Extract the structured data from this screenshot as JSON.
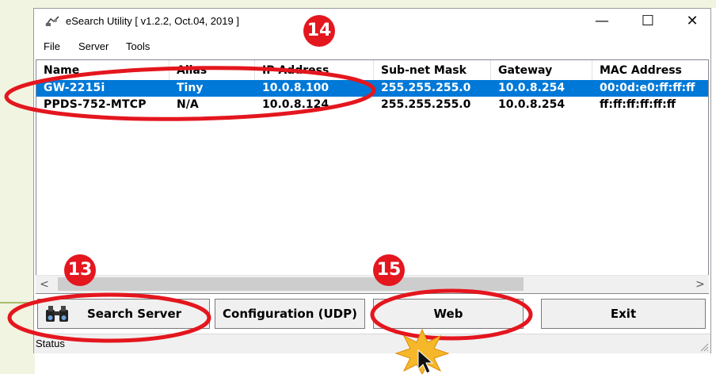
{
  "window": {
    "title": "eSearch Utility [ v1.2.2, Oct.04, 2019 ]",
    "controls": {
      "minimize": "—",
      "maximize": "☐",
      "close": "✕"
    }
  },
  "menu": [
    "File",
    "Server",
    "Tools"
  ],
  "table": {
    "columns": [
      "Name",
      "Alias",
      "IP Address",
      "Sub-net Mask",
      "Gateway",
      "MAC Address"
    ],
    "rows": [
      [
        "GW-2215i",
        "Tiny",
        "10.0.8.100",
        "255.255.255.0",
        "10.0.8.254",
        "00:0d:e0:ff:ff:ff"
      ],
      [
        "PPDS-752-MTCP",
        "N/A",
        "10.0.8.124",
        "255.255.255.0",
        "10.0.8.254",
        "ff:ff:ff:ff:ff:ff"
      ]
    ],
    "selected_row": 0
  },
  "scroll": {
    "left_arrow": "<",
    "right_arrow": ">"
  },
  "buttons": {
    "search": "Search Server",
    "config": "Configuration (UDP)",
    "web": "Web",
    "exit": "Exit"
  },
  "status": {
    "label": "Status"
  },
  "annotations": {
    "badge_13": "13",
    "badge_14": "14",
    "badge_15": "15"
  },
  "colors": {
    "selection": "#0078d7",
    "annotation_red": "#e4161e",
    "background_green": "#f1f4e1"
  }
}
